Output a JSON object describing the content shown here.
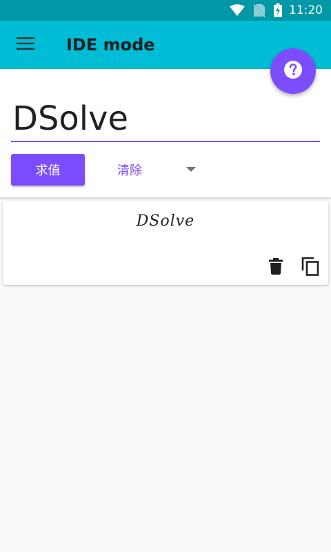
{
  "colors": {
    "status_bar": "#0097a7",
    "app_bar": "#00bcd4",
    "accent": "#7c4dff",
    "background": "#fafafa"
  },
  "status_bar": {
    "time": "11:20",
    "icons": [
      "wifi-icon",
      "no-sim-icon",
      "battery-charging-icon"
    ]
  },
  "app_bar": {
    "menu_icon": "menu-icon",
    "title": "IDE mode"
  },
  "fab": {
    "icon": "help-icon"
  },
  "input": {
    "value": "DSolve"
  },
  "buttons": {
    "eval_label": "求值",
    "clear_label": "清除",
    "dropdown_icon": "dropdown-arrow-icon"
  },
  "result": {
    "expression": "DSolve",
    "actions": [
      "delete-icon",
      "copy-icon"
    ]
  }
}
